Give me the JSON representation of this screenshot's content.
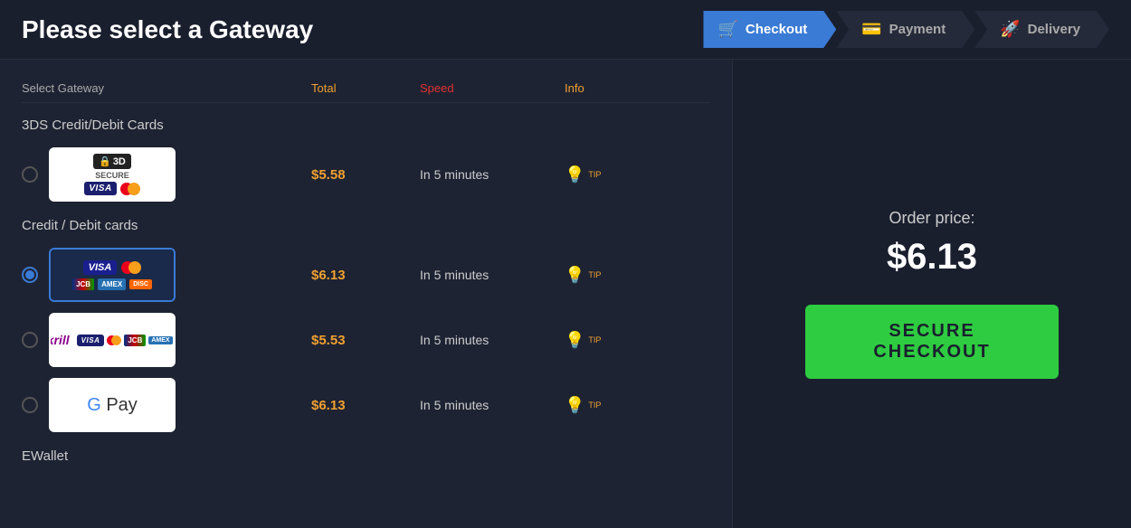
{
  "header": {
    "title": "Please select a Gateway",
    "steps": [
      {
        "label": "Checkout",
        "icon": "🛒",
        "active": true
      },
      {
        "label": "Payment",
        "icon": "💳",
        "active": false
      },
      {
        "label": "Delivery",
        "icon": "🚀",
        "active": false
      }
    ]
  },
  "table": {
    "columns": {
      "gateway": "Select Gateway",
      "total": "Total",
      "speed": "Speed",
      "info": "Info"
    }
  },
  "sections": [
    {
      "title": "3DS Credit/Debit Cards",
      "gateways": [
        {
          "id": "3ds",
          "selected": false,
          "price": "$5.58",
          "speed": "In 5 minutes",
          "type": "3ds"
        }
      ]
    },
    {
      "title": "Credit / Debit cards",
      "gateways": [
        {
          "id": "visa-multi",
          "selected": true,
          "price": "$6.13",
          "speed": "In 5 minutes",
          "type": "visa-multi"
        },
        {
          "id": "skrill",
          "selected": false,
          "price": "$5.53",
          "speed": "In 5 minutes",
          "type": "skrill"
        },
        {
          "id": "gpay",
          "selected": false,
          "price": "$6.13",
          "speed": "In 5 minutes",
          "type": "gpay"
        }
      ]
    },
    {
      "title": "EWallet",
      "gateways": []
    }
  ],
  "order": {
    "price_label": "Order price:",
    "price_value": "$6.13",
    "checkout_button": "SECURE CHECKOUT"
  }
}
